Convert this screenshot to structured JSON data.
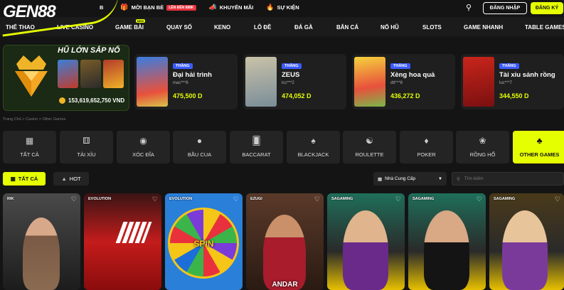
{
  "brand": {
    "logo": "GEN88",
    "accent": "#e6ff00"
  },
  "topbar": {
    "partial_link": "B",
    "links": [
      {
        "label": "MỜI BẠN BÈ",
        "badge": "LÊN ĐẾN 888K",
        "icon": "gift-icon"
      },
      {
        "label": "KHUYẾN MÃI",
        "icon": "megaphone-icon"
      },
      {
        "label": "SỰ KIỆN",
        "icon": "fire-icon"
      }
    ],
    "login_label": "ĐĂNG NHẬP",
    "register_label": "ĐĂNG KÝ"
  },
  "nav": {
    "items": [
      "THỂ THAO",
      "LIVE CASINO",
      "GAME BÀI",
      "QUAY SỐ",
      "KENO",
      "LÔ ĐỀ",
      "ĐÁ GÀ",
      "BẮN CÁ",
      "NỔ HŨ",
      "SLOTS",
      "GAME NHANH",
      "TABLE GAMES"
    ],
    "new_badge": "NEW"
  },
  "jackpot": {
    "title": "HŨ LỚN SẮP NỔ",
    "amount": "153,619,652,750 VND",
    "thumbs": [
      "SIÊU TRÍ TUỆ",
      "NĂM THẾ QUÀ",
      "THẦN TÀI PHÚ QUÝ"
    ]
  },
  "winners": [
    {
      "tag": "THẮNG",
      "game": "Đại hải trình",
      "user": "mac***6",
      "prize": "475,500 D",
      "thumb_text": "ĐẠI HẢI TRÌNH"
    },
    {
      "tag": "THẮNG",
      "game": "ZEUS",
      "user": "lcc***2",
      "prize": "474,052 D",
      "thumb_text": "ZEUS"
    },
    {
      "tag": "THẮNG",
      "game": "Xèng hoa quả",
      "user": "dtt***8",
      "prize": "436,272 D",
      "thumb_text": "XÈNG HOA QUẢ"
    },
    {
      "tag": "THẮNG",
      "game": "Tài xỉu sảnh rồng",
      "user": "luc***7",
      "prize": "344,550 D",
      "thumb_text": "TÀI XỈU SẢNH RỒNG"
    }
  ],
  "breadcrumb": "Trang Chủ > Casino > Other Games",
  "categories": [
    {
      "label": "TẤT CẢ",
      "icon": "grid-icon"
    },
    {
      "label": "TÀI XỈU",
      "icon": "dice-icon"
    },
    {
      "label": "XÓC ĐĨA",
      "icon": "disc-icon"
    },
    {
      "label": "BẦU CUA",
      "icon": "gourd-icon"
    },
    {
      "label": "BACCARAT",
      "icon": "cards-icon"
    },
    {
      "label": "BLACKJACK",
      "icon": "blackjack-icon"
    },
    {
      "label": "ROULETTE",
      "icon": "roulette-icon"
    },
    {
      "label": "POKER",
      "icon": "poker-icon"
    },
    {
      "label": "RỒNG HỔ",
      "icon": "dragon-icon"
    },
    {
      "label": "OTHER GAMES",
      "icon": "clubs-icon"
    }
  ],
  "filters": {
    "all_label": "TẤT CẢ",
    "hot_label": "HOT",
    "provider_label": "Nhà Cung Cấp",
    "search_placeholder": "Tìm kiếm"
  },
  "games": [
    {
      "provider": "RIK",
      "label": ""
    },
    {
      "provider": "EVOLUTION",
      "label": ""
    },
    {
      "provider": "EVOLUTION",
      "label": "SPIN"
    },
    {
      "provider": "EZUGI",
      "label": "ANDAR"
    },
    {
      "provider": "SAGAMING",
      "label": ""
    },
    {
      "provider": "SAGAMING",
      "label": ""
    },
    {
      "provider": "SAGAMING",
      "label": ""
    }
  ]
}
